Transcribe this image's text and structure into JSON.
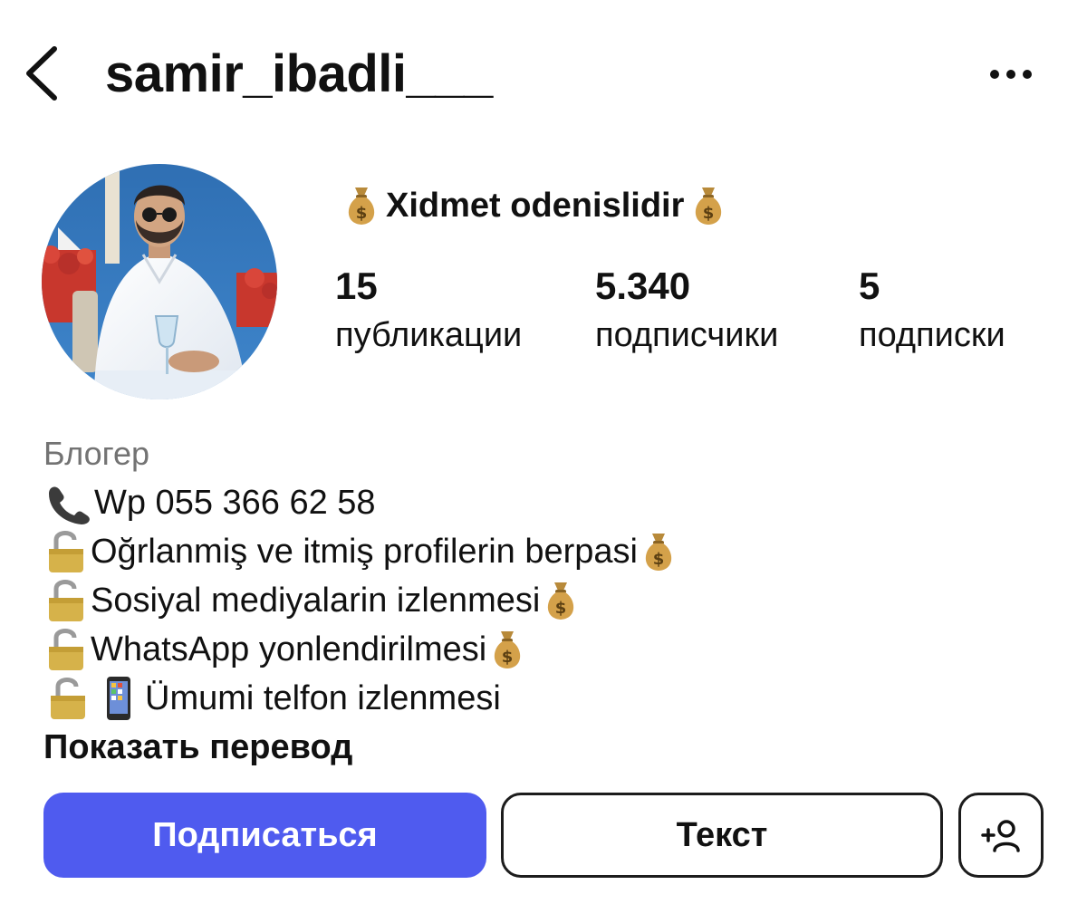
{
  "header": {
    "back_icon": "chevron-left-icon",
    "username": "samir_ibadli___",
    "more_icon": "more-horizontal-icon"
  },
  "profile": {
    "avatar_alt": "profile-photo",
    "full_name": "Xidmet odenislidir",
    "name_icons": [
      "money-bag-icon",
      "money-bag-icon"
    ],
    "stats": {
      "posts": {
        "value": "15",
        "label": "публикации"
      },
      "followers": {
        "value": "5.340",
        "label": "подписчики"
      },
      "following": {
        "value": "5",
        "label": "подписки"
      }
    }
  },
  "bio": {
    "category": "Блогер",
    "lines": [
      {
        "icons": [
          "telephone-icon"
        ],
        "text": "Wp 055 366 62 58",
        "trail": ""
      },
      {
        "icons": [
          "unlocked-padlock-icon"
        ],
        "text": "Oğrlanmiş ve itmiş profilerin berpasi",
        "trail": "money-bag-icon"
      },
      {
        "icons": [
          "unlocked-padlock-icon"
        ],
        "text": "Sosiyal mediyalarin izlenmesi",
        "trail": "money-bag-icon"
      },
      {
        "icons": [
          "unlocked-padlock-icon"
        ],
        "text": "WhatsApp yonlendirilmesi",
        "trail": "money-bag-icon"
      },
      {
        "icons": [
          "unlocked-padlock-icon",
          "mobile-phone-icon"
        ],
        "text": "Ümumi telfon izlenmesi",
        "trail": ""
      }
    ],
    "show_translation": "Показать перевод"
  },
  "actions": {
    "follow_label": "Подписаться",
    "message_label": "Текст",
    "add_user_icon": "add-user-icon"
  },
  "colors": {
    "follow_button": "#4f5bef",
    "secondary_text": "#737373",
    "text": "#111111"
  }
}
